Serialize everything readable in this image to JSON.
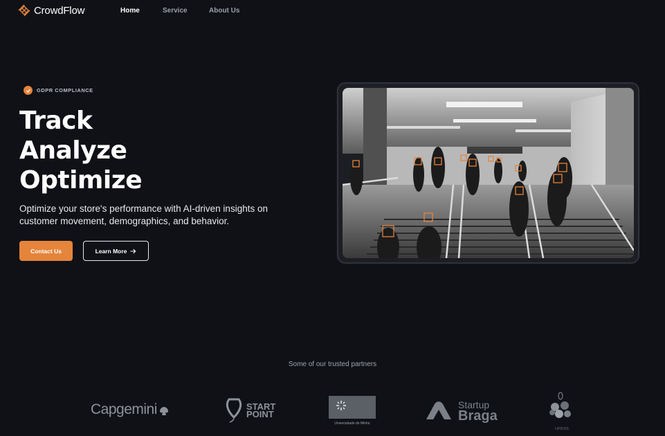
{
  "brand": {
    "name": "CrowdFlow",
    "accent": "#e5843b"
  },
  "nav": {
    "home": "Home",
    "service": "Service",
    "about": "About Us"
  },
  "hero": {
    "badge": "GDPR COMPLIANCE",
    "headline": [
      "Track",
      "Analyze",
      "Optimize"
    ],
    "subtext": "Optimize your store's performance with AI-driven insights on customer movement, demographics, and behavior.",
    "contact_label": "Contact Us",
    "learn_label": "Learn More",
    "learn_icon": "arrow-right-icon"
  },
  "partners": {
    "heading": "Some of our trusted partners",
    "logos": [
      {
        "name": "Capgemini",
        "text": "Capgemini"
      },
      {
        "name": "Start Point",
        "line1": "START",
        "line2": "POINT"
      },
      {
        "name": "Universidade do Minho",
        "text": "Universidade do Minho"
      },
      {
        "name": "Startup Braga",
        "line1": "Startup",
        "line2": "Braga"
      },
      {
        "name": "Lipidos",
        "text": "LIPIDOS"
      }
    ]
  },
  "colors": {
    "background": "#101116",
    "accent": "#e5843b",
    "muted_text": "#9ba3b0"
  }
}
